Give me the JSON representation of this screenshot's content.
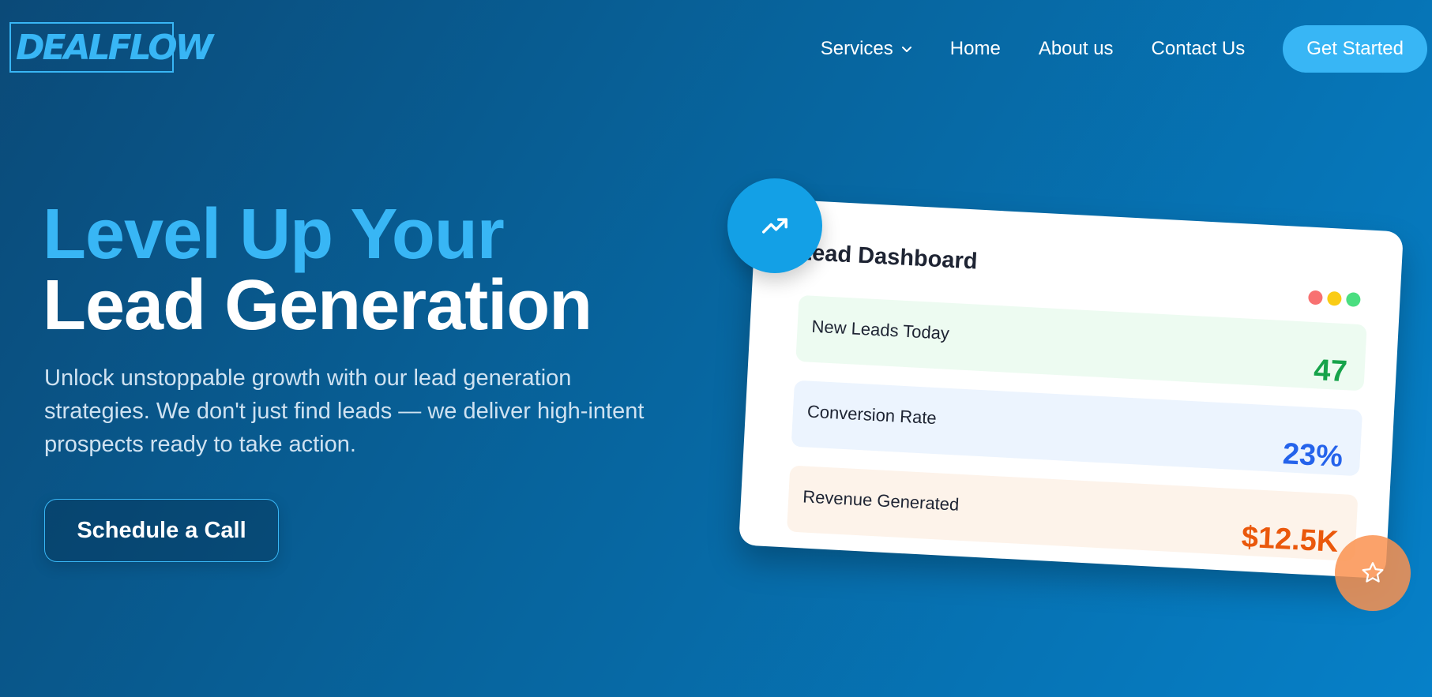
{
  "brand": {
    "logo_text": "DEALFLOW"
  },
  "nav": {
    "items": [
      {
        "label": "Services",
        "has_dropdown": true
      },
      {
        "label": "Home"
      },
      {
        "label": "About us"
      },
      {
        "label": "Contact Us"
      }
    ],
    "cta_label": "Get Started"
  },
  "hero": {
    "title_line1": "Level Up Your",
    "title_line2": "Lead Generation",
    "subtitle": "Unlock unstoppable growth with our lead generation strategies. We don't just find leads — we deliver high-intent prospects ready to take action.",
    "cta_label": "Schedule a Call"
  },
  "dashboard": {
    "title": "Lead Dashboard",
    "window_dots": [
      "#f87171",
      "#facc15",
      "#4ade80"
    ],
    "metrics": [
      {
        "label": "New Leads Today",
        "value": "47",
        "color": "#16a34a"
      },
      {
        "label": "Conversion Rate",
        "value": "23%",
        "color": "#2563eb"
      },
      {
        "label": "Revenue Generated",
        "value": "$12.5K",
        "color": "#ea580c"
      }
    ],
    "icons": {
      "top_badge": "trending-up-icon",
      "bottom_badge": "star-icon"
    }
  },
  "colors": {
    "accent": "#38b6f5",
    "background_start": "#0b4a78",
    "background_end": "#0680c8"
  }
}
